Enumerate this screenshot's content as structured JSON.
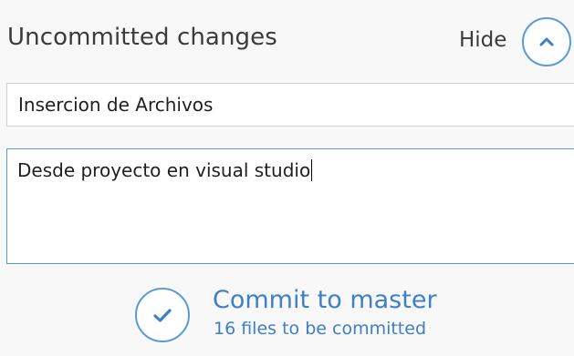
{
  "header": {
    "title": "Uncommitted changes",
    "hide_label": "Hide",
    "hide_icon": "chevron-up-icon"
  },
  "commit_form": {
    "summary_value": "Insercion de Archivos",
    "description_value": "Desde proyecto en visual studio"
  },
  "commit_action": {
    "title": "Commit to master",
    "subtitle": "16 files to be committed",
    "icon": "check-icon"
  },
  "colors": {
    "accent": "#5b9bd5",
    "link": "#3d7fc9",
    "text": "#3b3b3b",
    "background": "#f8f8f8"
  }
}
